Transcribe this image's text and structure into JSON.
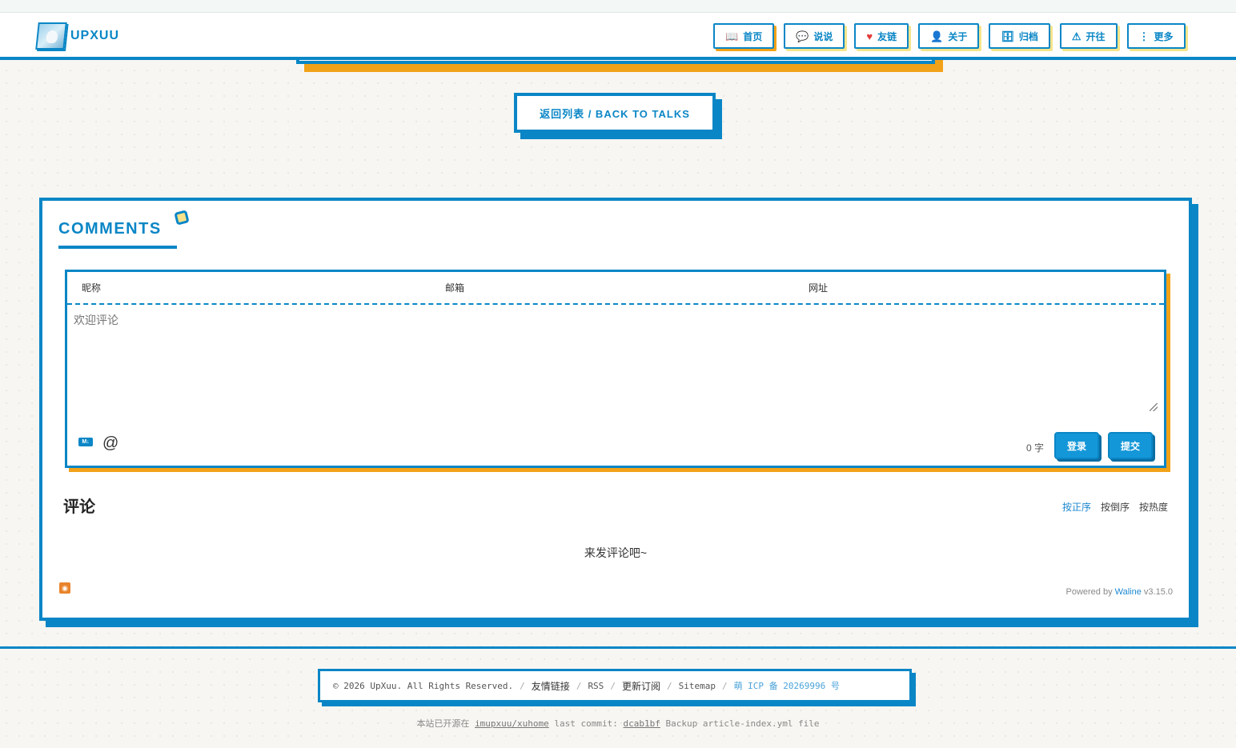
{
  "site": {
    "logo_text": "UPXUU"
  },
  "nav": [
    {
      "icon": "book-icon",
      "glyph": "📖",
      "label": "首页"
    },
    {
      "icon": "chat-icon",
      "glyph": "💬",
      "label": "说说"
    },
    {
      "icon": "heart-icon",
      "glyph": "♥",
      "label": "友链"
    },
    {
      "icon": "user-icon",
      "glyph": "👤",
      "label": "关于"
    },
    {
      "icon": "archive-icon",
      "glyph": "🗄",
      "label": "归档"
    },
    {
      "icon": "travel-icon",
      "glyph": "⚠",
      "label": "开往"
    },
    {
      "icon": "more-icon",
      "glyph": "⋮",
      "label": "更多"
    }
  ],
  "back_button": {
    "label": "返回列表 / BACK TO TALKS"
  },
  "comments": {
    "title": "COMMENTS",
    "fields": {
      "nick": "昵称",
      "mail": "邮箱",
      "link": "网址"
    },
    "placeholder": "欢迎评论",
    "md_label": "M↓",
    "word_count": "0 字",
    "login_label": "登录",
    "submit_label": "提交",
    "list_title": "评论",
    "sorts": [
      "按正序",
      "按倒序",
      "按热度"
    ],
    "empty_text": "来发评论吧~",
    "powered_prefix": "Powered by ",
    "powered_brand": "Waline",
    "powered_version": " v3.15.0"
  },
  "footer": {
    "copyright": "© 2026 UpXuu. All Rights Reserved.",
    "links": [
      "友情链接",
      "RSS",
      "更新订阅",
      "Sitemap"
    ],
    "icp": "萌 ICP 备 20269996 号",
    "source_prefix": "本站已开源在",
    "repo": "imupxuu/xuhome",
    "commit_prefix": "last commit:",
    "commit_hash": "dcab1bf",
    "commit_msg": "Backup article-index.yml file"
  },
  "colors": {
    "primary": "#0a86c6",
    "accent": "#f2a218",
    "button": "#1497d8"
  }
}
